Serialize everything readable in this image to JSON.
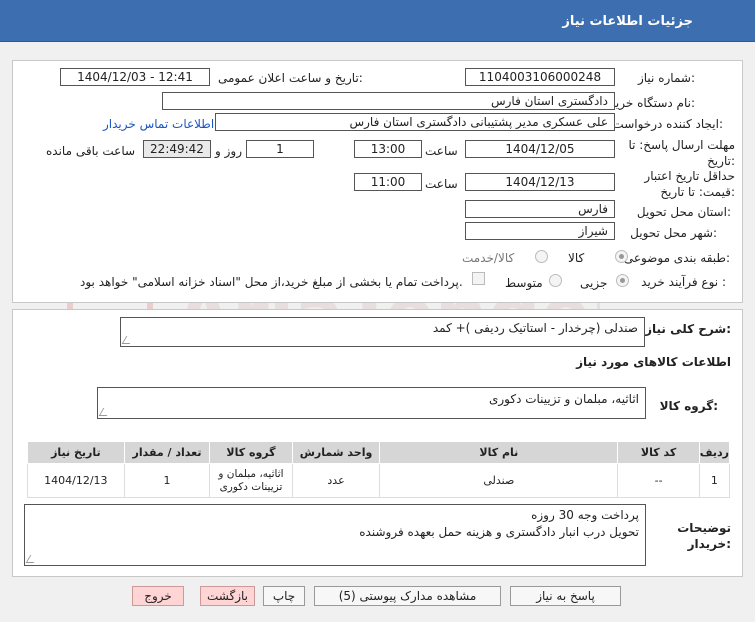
{
  "page": {
    "title": "جزئیات اطلاعات نیاز"
  },
  "form": {
    "need_number_label": "شماره نیاز:",
    "need_number": "1104003106000248",
    "announce_label": "تاریخ و ساعت اعلان عمومی:",
    "announce_value": "1404/12/03 - 12:41",
    "buyer_org_label": "نام دستگاه خریدار:",
    "buyer_org": "دادگستری استان فارس",
    "creator_label": "ایجاد کننده درخواست:",
    "creator": "علی عسکری مدیر پشتیبانی دادگستری استان فارس",
    "contact_link": "اطلاعات تماس خریدار",
    "reply_deadline_label": "مهلت ارسال پاسخ: تا تاریخ:",
    "reply_date": "1404/12/05",
    "time_label": "ساعت",
    "reply_time": "13:00",
    "days_value": "1",
    "days_label": "روز و",
    "remaining_time": "22:49:42",
    "remaining_label": "ساعت باقی مانده",
    "price_validity_label": "حداقل تاریخ اعتبار قیمت: تا تاریخ:",
    "price_date": "1404/12/13",
    "price_time": "11:00",
    "province_label": "استان محل تحویل:",
    "province": "فارس",
    "city_label": "شهر محل تحویل:",
    "city": "شیراز",
    "category_label": "طبقه بندی موضوعی:",
    "category_goods": "کالا",
    "category_service": "کالا/خدمت",
    "process_label": "نوع فرآیند خرید :",
    "process_partial": "جزیی",
    "process_medium": "متوسط",
    "payment_note": "پرداخت تمام یا بخشی از مبلغ خرید،از محل \"اسناد خزانه اسلامی\" خواهد بود."
  },
  "details": {
    "summary_label": "شرح کلی نیاز:",
    "summary": "صندلی (چرخدار - استاتیک ردیفی )+ کمد",
    "goods_info_heading": "اطلاعات کالاهای مورد نیاز",
    "goods_group_label": "گروه کالا:",
    "goods_group": "اثاثیه، مبلمان و تزیینات دکوری"
  },
  "table": {
    "headers": [
      "ردیف",
      "کد کالا",
      "نام کالا",
      "واحد شمارش",
      "گروه کالا",
      "تعداد / مقدار",
      "تاریخ نیاز"
    ],
    "rows": [
      [
        "1",
        "--",
        "صندلی",
        "عدد",
        "اثاثیه، مبلمان و تزیینات دکوری",
        "1",
        "1404/12/13"
      ]
    ]
  },
  "notes": {
    "label": "توضیحات خریدار:",
    "line1": "پرداخت وجه 30 روزه",
    "line2": "تحویل درب انبار دادگستری و هزینه حمل بعهده فروشنده"
  },
  "buttons": {
    "reply": "پاسخ به نیاز",
    "attachments": "مشاهده مدارک پیوستی (5)",
    "print": "چاپ",
    "back": "بازگشت",
    "exit": "خروج"
  },
  "watermark": {
    "text": "AriaTender.neT"
  },
  "colors": {
    "titlebar": "#3d6fb0",
    "link": "#1a56c4",
    "exit": "#ffd4d4"
  }
}
